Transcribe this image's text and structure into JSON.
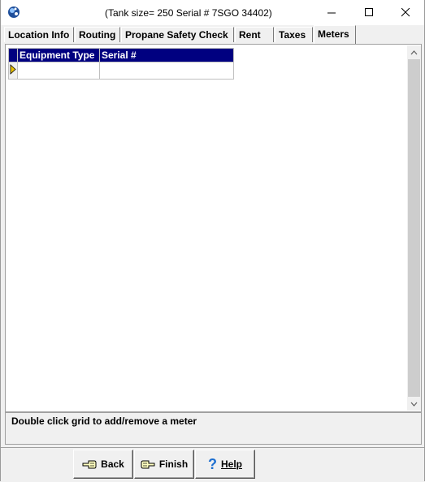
{
  "window": {
    "title": "(Tank size= 250 Serial # 7SGO 34402)"
  },
  "tabs": [
    {
      "label": "Location Info"
    },
    {
      "label": "Routing"
    },
    {
      "label": "Propane Safety Check"
    },
    {
      "label": "Rent"
    },
    {
      "label": "Taxes"
    },
    {
      "label": "Meters",
      "active": true
    }
  ],
  "grid": {
    "columns": [
      "Equipment Type",
      "Serial #"
    ],
    "rows": [
      [
        "",
        ""
      ]
    ]
  },
  "hint": "Double click grid to add/remove a meter",
  "buttons": {
    "back": "Back",
    "finish": "Finish",
    "help": "Help"
  },
  "icons": {
    "app": "app-logo-icon",
    "back": "back-hand-icon",
    "finish": "finish-hand-icon",
    "help": "question-mark-icon"
  },
  "colors": {
    "grid_header": "#000080",
    "help_icon": "#1e6fd0"
  }
}
